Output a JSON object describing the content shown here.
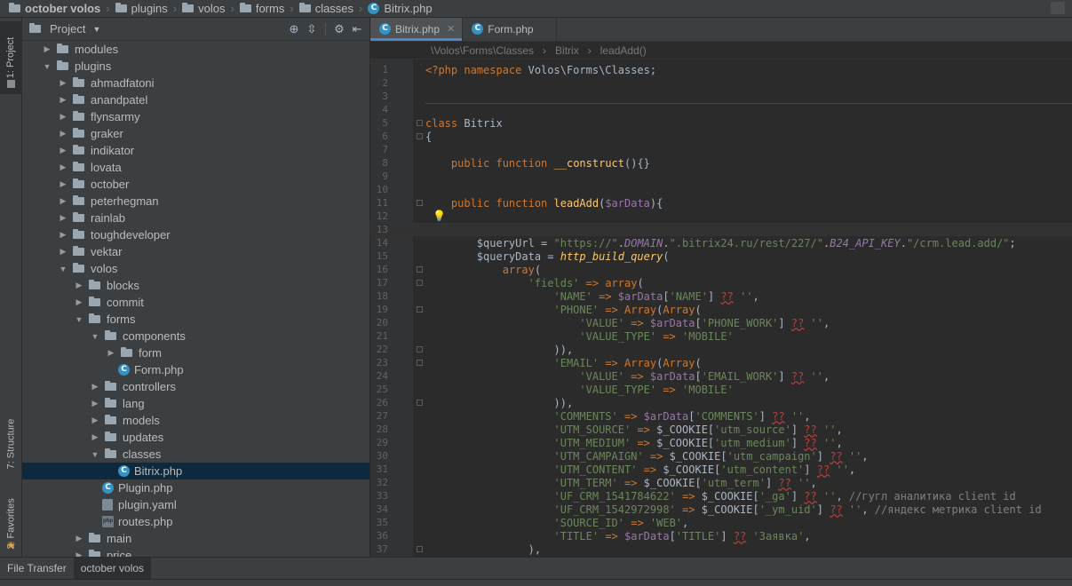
{
  "breadcrumb": {
    "items": [
      "october volos",
      "plugins",
      "volos",
      "forms",
      "classes",
      "Bitrix.php"
    ]
  },
  "left_strip": {
    "project_tab": "1: Project",
    "structure_tab": "7: Structure",
    "favorites_tab": "2: Favorites"
  },
  "project_panel": {
    "title": "Project",
    "tree": [
      {
        "label": "modules",
        "depth": 1,
        "arrow": "collapsed",
        "icon": "folder"
      },
      {
        "label": "plugins",
        "depth": 1,
        "arrow": "expanded",
        "icon": "folder"
      },
      {
        "label": "ahmadfatoni",
        "depth": 2,
        "arrow": "collapsed",
        "icon": "folder"
      },
      {
        "label": "anandpatel",
        "depth": 2,
        "arrow": "collapsed",
        "icon": "folder"
      },
      {
        "label": "flynsarmy",
        "depth": 2,
        "arrow": "collapsed",
        "icon": "folder"
      },
      {
        "label": "graker",
        "depth": 2,
        "arrow": "collapsed",
        "icon": "folder"
      },
      {
        "label": "indikator",
        "depth": 2,
        "arrow": "collapsed",
        "icon": "folder"
      },
      {
        "label": "lovata",
        "depth": 2,
        "arrow": "collapsed",
        "icon": "folder"
      },
      {
        "label": "october",
        "depth": 2,
        "arrow": "collapsed",
        "icon": "folder"
      },
      {
        "label": "peterhegman",
        "depth": 2,
        "arrow": "collapsed",
        "icon": "folder"
      },
      {
        "label": "rainlab",
        "depth": 2,
        "arrow": "collapsed",
        "icon": "folder"
      },
      {
        "label": "toughdeveloper",
        "depth": 2,
        "arrow": "collapsed",
        "icon": "folder"
      },
      {
        "label": "vektar",
        "depth": 2,
        "arrow": "collapsed",
        "icon": "folder"
      },
      {
        "label": "volos",
        "depth": 2,
        "arrow": "expanded",
        "icon": "folder"
      },
      {
        "label": "blocks",
        "depth": 3,
        "arrow": "collapsed",
        "icon": "folder"
      },
      {
        "label": "commit",
        "depth": 3,
        "arrow": "collapsed",
        "icon": "folder"
      },
      {
        "label": "forms",
        "depth": 3,
        "arrow": "expanded",
        "icon": "folder"
      },
      {
        "label": "components",
        "depth": 4,
        "arrow": "expanded",
        "icon": "folder"
      },
      {
        "label": "form",
        "depth": 5,
        "arrow": "collapsed",
        "icon": "folder"
      },
      {
        "label": "Form.php",
        "depth": 5,
        "arrow": "none",
        "icon": "php-class"
      },
      {
        "label": "controllers",
        "depth": 4,
        "arrow": "collapsed",
        "icon": "folder"
      },
      {
        "label": "lang",
        "depth": 4,
        "arrow": "collapsed",
        "icon": "folder"
      },
      {
        "label": "models",
        "depth": 4,
        "arrow": "collapsed",
        "icon": "folder"
      },
      {
        "label": "updates",
        "depth": 4,
        "arrow": "collapsed",
        "icon": "folder"
      },
      {
        "label": "classes",
        "depth": 4,
        "arrow": "expanded",
        "icon": "folder"
      },
      {
        "label": "Bitrix.php",
        "depth": 5,
        "arrow": "none",
        "icon": "php-class",
        "selected": true
      },
      {
        "label": "Plugin.php",
        "depth": 4,
        "arrow": "none",
        "icon": "php-class"
      },
      {
        "label": "plugin.yaml",
        "depth": 4,
        "arrow": "none",
        "icon": "yaml"
      },
      {
        "label": "routes.php",
        "depth": 4,
        "arrow": "none",
        "icon": "php-file"
      },
      {
        "label": "main",
        "depth": 3,
        "arrow": "collapsed",
        "icon": "folder"
      },
      {
        "label": "price",
        "depth": 3,
        "arrow": "collapsed",
        "icon": "folder"
      }
    ]
  },
  "editor": {
    "tabs": [
      {
        "label": "Bitrix.php",
        "active": true
      },
      {
        "label": "Form.php",
        "active": false
      }
    ],
    "nav_crumb": [
      "\\Volos\\Forms\\Classes",
      "Bitrix",
      "leadAdd()"
    ],
    "current_line": 13,
    "lines": [
      {
        "n": "1",
        "html": "<span class=\"kw\">&lt;?php namespace</span> Volos\\Forms\\Classes;"
      },
      {
        "n": "2",
        "html": ""
      },
      {
        "n": "3",
        "html": ""
      },
      {
        "n": "4",
        "html": ""
      },
      {
        "n": "5",
        "html": "<span class=\"kw\">class</span> Bitrix"
      },
      {
        "n": "6",
        "html": "{"
      },
      {
        "n": "7",
        "html": ""
      },
      {
        "n": "8",
        "html": "    <span class=\"kw\">public function</span> <span class=\"fn\">__construct</span>(){}"
      },
      {
        "n": "9",
        "html": ""
      },
      {
        "n": "10",
        "html": ""
      },
      {
        "n": "11",
        "html": "    <span class=\"kw\">public function</span> <span class=\"fn\">leadAdd</span>(<span class=\"var\">$arData</span>){"
      },
      {
        "n": "12",
        "html": ""
      },
      {
        "n": "13",
        "html": ""
      },
      {
        "n": "14",
        "html": "        <span class=\"code\">$queryUrl</span> = <span class=\"str\">\"https://\"</span>.<span class=\"const\">DOMAIN</span>.<span class=\"str\">\".bitrix24.ru/rest/227/\"</span>.<span class=\"const\">B24_API_KEY</span>.<span class=\"str\">\"/crm.lead.add/\"</span>;"
      },
      {
        "n": "15",
        "html": "        <span class=\"code\">$queryData</span> = <span class=\"it\">http_build_query</span>("
      },
      {
        "n": "16",
        "html": "            <span class=\"kw\">array</span>("
      },
      {
        "n": "17",
        "html": "                <span class=\"str\">'fields'</span> <span class=\"op\">=&gt;</span> <span class=\"kw\">array</span>("
      },
      {
        "n": "18",
        "html": "                    <span class=\"str\">'NAME'</span> <span class=\"op\">=&gt;</span> <span class=\"var\">$arData</span>[<span class=\"str\">'NAME'</span>] <span class=\"err\">??</span> <span class=\"str\">''</span>,"
      },
      {
        "n": "19",
        "html": "                    <span class=\"str\">'PHONE'</span> <span class=\"op\">=&gt;</span> <span class=\"kw\">Array</span>(<span class=\"kw\">Array</span>("
      },
      {
        "n": "20",
        "html": "                        <span class=\"str\">'VALUE'</span> <span class=\"op\">=&gt;</span> <span class=\"var\">$arData</span>[<span class=\"str\">'PHONE_WORK'</span>] <span class=\"err\">??</span> <span class=\"str\">''</span>,"
      },
      {
        "n": "21",
        "html": "                        <span class=\"str\">'VALUE_TYPE'</span> <span class=\"op\">=&gt;</span> <span class=\"str\">'MOBILE'</span>"
      },
      {
        "n": "22",
        "html": "                    )),"
      },
      {
        "n": "23",
        "html": "                    <span class=\"str\">'EMAIL'</span> <span class=\"op\">=&gt;</span> <span class=\"kw\">Array</span>(<span class=\"kw\">Array</span>("
      },
      {
        "n": "24",
        "html": "                        <span class=\"str\">'VALUE'</span> <span class=\"op\">=&gt;</span> <span class=\"var\">$arData</span>[<span class=\"str\">'EMAIL_WORK'</span>] <span class=\"err\">??</span> <span class=\"str\">''</span>,"
      },
      {
        "n": "25",
        "html": "                        <span class=\"str\">'VALUE_TYPE'</span> <span class=\"op\">=&gt;</span> <span class=\"str\">'MOBILE'</span>"
      },
      {
        "n": "26",
        "html": "                    )),"
      },
      {
        "n": "27",
        "html": "                    <span class=\"str\">'COMMENTS'</span> <span class=\"op\">=&gt;</span> <span class=\"var\">$arData</span>[<span class=\"str\">'COMMENTS'</span>] <span class=\"err\">??</span> <span class=\"str\">''</span>,"
      },
      {
        "n": "28",
        "html": "                    <span class=\"str\">'UTM_SOURCE'</span> <span class=\"op\">=&gt;</span> $_COOKIE[<span class=\"str\">'utm_source'</span>] <span class=\"err\">??</span> <span class=\"str\">''</span>,"
      },
      {
        "n": "29",
        "html": "                    <span class=\"str\">'UTM_MEDIUM'</span> <span class=\"op\">=&gt;</span> $_COOKIE[<span class=\"str\">'utm_medium'</span>] <span class=\"err\">??</span> <span class=\"str\">''</span>,"
      },
      {
        "n": "30",
        "html": "                    <span class=\"str\">'UTM_CAMPAIGN'</span> <span class=\"op\">=&gt;</span> $_COOKIE[<span class=\"str\">'utm_campaign'</span>] <span class=\"err\">??</span> <span class=\"str\">''</span>,"
      },
      {
        "n": "31",
        "html": "                    <span class=\"str\">'UTM_CONTENT'</span> <span class=\"op\">=&gt;</span> $_COOKIE[<span class=\"str\">'utm_content'</span>] <span class=\"err\">??</span> <span class=\"str\">''</span>,"
      },
      {
        "n": "32",
        "html": "                    <span class=\"str\">'UTM_TERM'</span> <span class=\"op\">=&gt;</span> $_COOKIE[<span class=\"str\">'utm_term'</span>] <span class=\"err\">??</span> <span class=\"str\">''</span>,"
      },
      {
        "n": "33",
        "html": "                    <span class=\"str\">'UF_CRM_1541784622'</span> <span class=\"op\">=&gt;</span> $_COOKIE[<span class=\"str\">'_ga'</span>] <span class=\"err\">??</span> <span class=\"str\">''</span>, <span class=\"cmt\">//гугл аналитика client id</span>"
      },
      {
        "n": "34",
        "html": "                    <span class=\"str\">'UF_CRM_1542972998'</span> <span class=\"op\">=&gt;</span> $_COOKIE[<span class=\"str\">'_ym_uid'</span>] <span class=\"err\">??</span> <span class=\"str\">''</span>, <span class=\"cmt\">//яндекс метрика client id</span>"
      },
      {
        "n": "35",
        "html": "                    <span class=\"str\">'SOURCE_ID'</span> <span class=\"op\">=&gt;</span> <span class=\"str\">'WEB'</span>,"
      },
      {
        "n": "36",
        "html": "                    <span class=\"str\">'TITLE'</span> <span class=\"op\">=&gt;</span> <span class=\"var\">$arData</span>[<span class=\"str\">'TITLE'</span>] <span class=\"err\">??</span> <span class=\"str\">'Заявка'</span>,"
      },
      {
        "n": "37",
        "html": "                ),"
      }
    ]
  },
  "bottom_bar": {
    "tabs": [
      {
        "label": "File Transfer",
        "active": false
      },
      {
        "label": "october volos",
        "active": true
      }
    ]
  },
  "colors": {
    "accent": "#4a88c7",
    "selection": "#0d293e",
    "panel_bg": "#3c3f41",
    "editor_bg": "#2b2b2b"
  },
  "icons": [
    "folder-icon",
    "php-class-icon",
    "target-icon",
    "collapse-icon",
    "gear-icon",
    "hide-icon",
    "close-icon",
    "lightbulb-icon",
    "star-icon"
  ]
}
